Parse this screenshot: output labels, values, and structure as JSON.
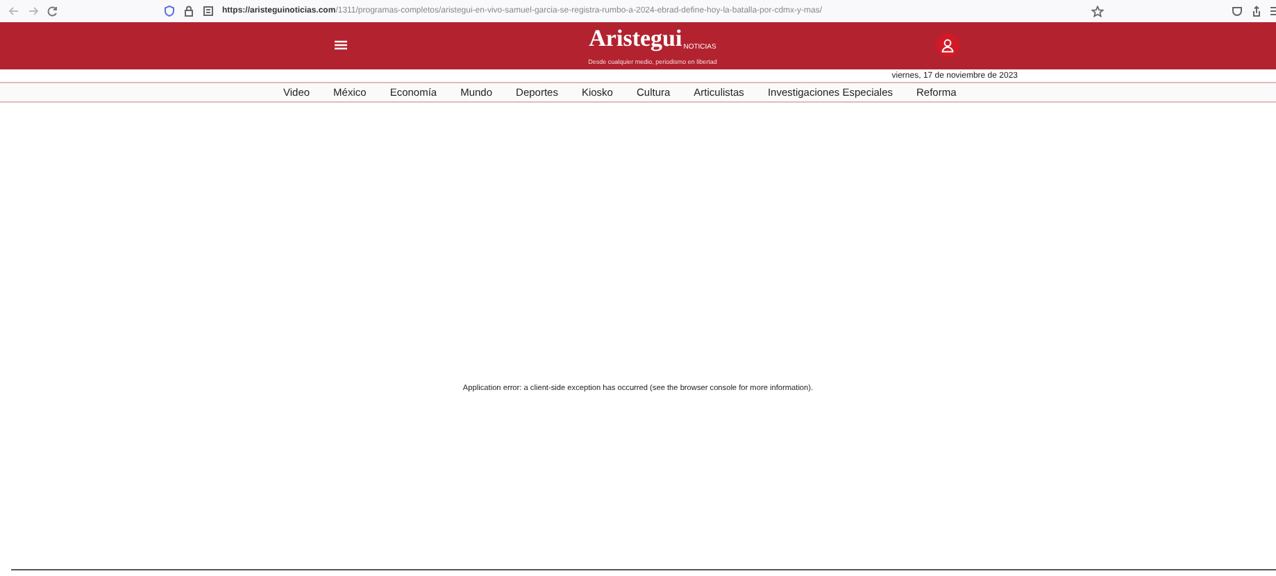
{
  "browser": {
    "url_host": "https://aristeguinoticias.com",
    "url_path": "/1311/programas-completos/aristegui-en-vivo-samuel-garcia-se-registra-rumbo-a-2024-ebrad-define-hoy-la-batalla-por-cdmx-y-mas/"
  },
  "header": {
    "logo": "Aristegui",
    "logo_sub": "NOTICIAS",
    "tagline": "Desde cualquier medio, periodismo en libertad",
    "date": "viernes, 17 de noviembre de 2023"
  },
  "nav": [
    "Video",
    "México",
    "Economía",
    "Mundo",
    "Deportes",
    "Kiosko",
    "Cultura",
    "Articulistas",
    "Investigaciones Especiales",
    "Reforma"
  ],
  "error": "Application error: a client-side exception has occurred (see the browser console for more information)."
}
